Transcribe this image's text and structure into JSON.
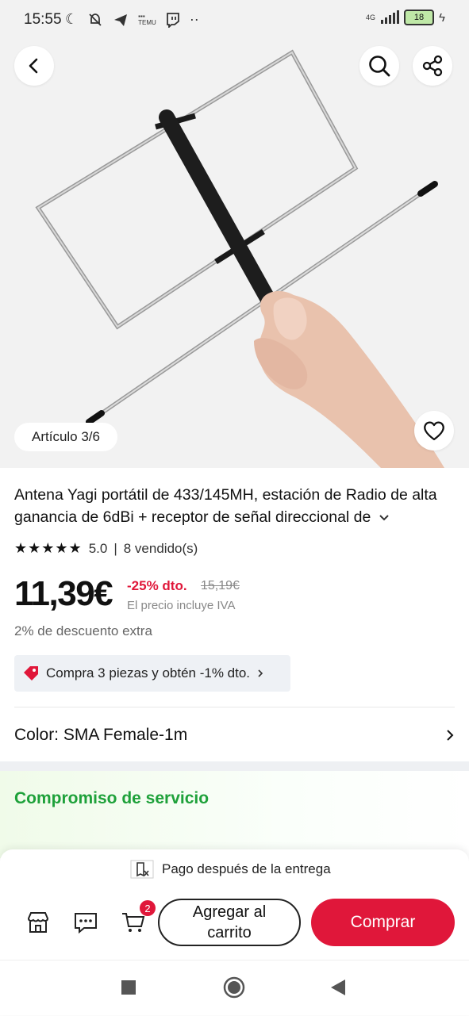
{
  "status_bar": {
    "time": "15:55",
    "network": "4G",
    "battery": "18"
  },
  "hero": {
    "image_counter": "Artículo 3/6"
  },
  "product": {
    "title": "Antena Yagi portátil de 433/145MH, estación de Radio de alta ganancia de 6dBi + receptor de señal direccional de",
    "rating": "5.0",
    "sold": "8 vendido(s)",
    "stars": 5,
    "price": "11,39€",
    "discount": "-25% dto.",
    "old_price": "15,19€",
    "tax_note": "El precio incluye IVA",
    "extra_discount": "2% de descuento extra",
    "promo": "Compra 3 piezas y obtén -1% dto.",
    "color_label": "Color: SMA Female-1m"
  },
  "service": {
    "title": "Compromiso de servicio"
  },
  "bottom": {
    "pay_note": "Pago después de la entrega",
    "cart_count": "2",
    "add_to_cart": "Agregar al carrito",
    "buy": "Comprar"
  },
  "colors": {
    "accent": "#e0173a",
    "service_green": "#1ea13a"
  }
}
